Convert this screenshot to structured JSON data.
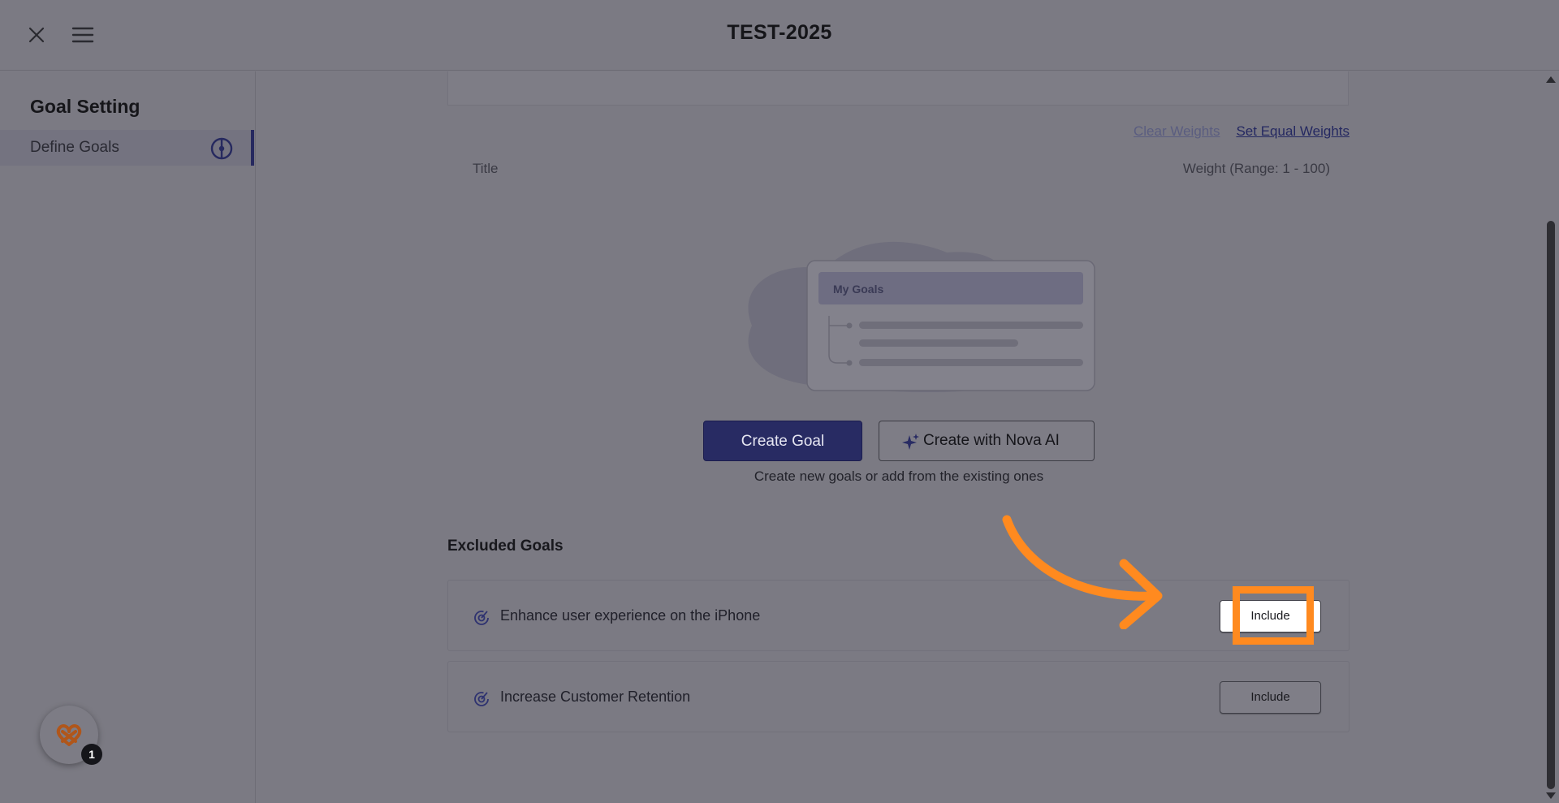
{
  "header": {
    "title": "TEST-2025"
  },
  "sidebar": {
    "heading": "Goal Setting",
    "items": [
      {
        "label": "Define Goals"
      }
    ]
  },
  "main": {
    "clear_weights": "Clear Weights",
    "set_equal_weights": "Set Equal Weights",
    "col_title": "Title",
    "col_weight": "Weight (Range: 1 - 100)",
    "illustration_label": "My Goals",
    "create_goal": "Create Goal",
    "create_nova": "Create with Nova AI",
    "helper": "Create new goals or add from the existing ones"
  },
  "excluded": {
    "heading": "Excluded Goals",
    "goals": [
      {
        "title": "Enhance user experience on the iPhone",
        "action": "Include"
      },
      {
        "title": "Increase Customer Retention",
        "action": "Include"
      }
    ]
  },
  "help": {
    "badge": "1"
  },
  "colors": {
    "primary": "#282b63",
    "highlight": "#ff8a1f",
    "overlay": "#7b7a83"
  }
}
